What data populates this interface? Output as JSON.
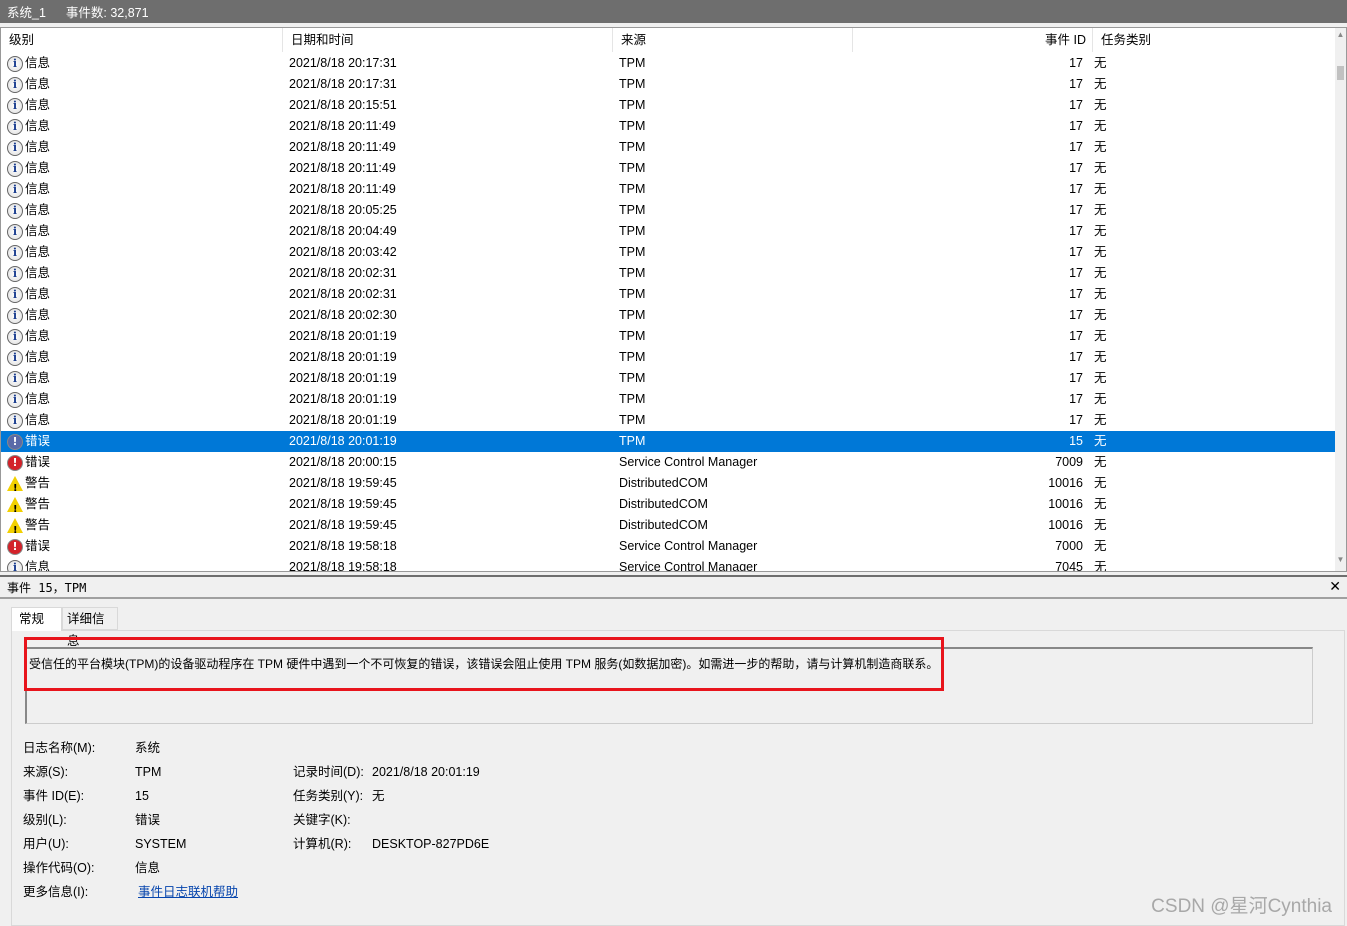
{
  "title": {
    "log": "系统_1",
    "count": "事件数: 32,871"
  },
  "columns": [
    "级别",
    "日期和时间",
    "来源",
    "事件 ID",
    "任务类别"
  ],
  "rows": [
    [
      "info",
      "信息",
      "2021/8/18 20:17:31",
      "TPM",
      "17",
      "无"
    ],
    [
      "info",
      "信息",
      "2021/8/18 20:17:31",
      "TPM",
      "17",
      "无"
    ],
    [
      "info",
      "信息",
      "2021/8/18 20:15:51",
      "TPM",
      "17",
      "无"
    ],
    [
      "info",
      "信息",
      "2021/8/18 20:11:49",
      "TPM",
      "17",
      "无"
    ],
    [
      "info",
      "信息",
      "2021/8/18 20:11:49",
      "TPM",
      "17",
      "无"
    ],
    [
      "info",
      "信息",
      "2021/8/18 20:11:49",
      "TPM",
      "17",
      "无"
    ],
    [
      "info",
      "信息",
      "2021/8/18 20:11:49",
      "TPM",
      "17",
      "无"
    ],
    [
      "info",
      "信息",
      "2021/8/18 20:05:25",
      "TPM",
      "17",
      "无"
    ],
    [
      "info",
      "信息",
      "2021/8/18 20:04:49",
      "TPM",
      "17",
      "无"
    ],
    [
      "info",
      "信息",
      "2021/8/18 20:03:42",
      "TPM",
      "17",
      "无"
    ],
    [
      "info",
      "信息",
      "2021/8/18 20:02:31",
      "TPM",
      "17",
      "无"
    ],
    [
      "info",
      "信息",
      "2021/8/18 20:02:31",
      "TPM",
      "17",
      "无"
    ],
    [
      "info",
      "信息",
      "2021/8/18 20:02:30",
      "TPM",
      "17",
      "无"
    ],
    [
      "info",
      "信息",
      "2021/8/18 20:01:19",
      "TPM",
      "17",
      "无"
    ],
    [
      "info",
      "信息",
      "2021/8/18 20:01:19",
      "TPM",
      "17",
      "无"
    ],
    [
      "info",
      "信息",
      "2021/8/18 20:01:19",
      "TPM",
      "17",
      "无"
    ],
    [
      "info",
      "信息",
      "2021/8/18 20:01:19",
      "TPM",
      "17",
      "无"
    ],
    [
      "info",
      "信息",
      "2021/8/18 20:01:19",
      "TPM",
      "17",
      "无"
    ],
    [
      "errsel",
      "错误",
      "2021/8/18 20:01:19",
      "TPM",
      "15",
      "无"
    ],
    [
      "err",
      "错误",
      "2021/8/18 20:00:15",
      "Service Control Manager",
      "7009",
      "无"
    ],
    [
      "warn",
      "警告",
      "2021/8/18 19:59:45",
      "DistributedCOM",
      "10016",
      "无"
    ],
    [
      "warn",
      "警告",
      "2021/8/18 19:59:45",
      "DistributedCOM",
      "10016",
      "无"
    ],
    [
      "warn",
      "警告",
      "2021/8/18 19:59:45",
      "DistributedCOM",
      "10016",
      "无"
    ],
    [
      "err",
      "错误",
      "2021/8/18 19:58:18",
      "Service Control Manager",
      "7000",
      "无"
    ],
    [
      "info",
      "信息",
      "2021/8/18 19:58:18",
      "Service Control Manager",
      "7045",
      "无"
    ]
  ],
  "selected_index": 18,
  "detail": {
    "header": "事件 15，TPM",
    "tabs": [
      "常规",
      "详细信息"
    ],
    "description": "受信任的平台模块(TPM)的设备驱动程序在 TPM 硬件中遇到一个不可恢复的错误，该错误会阻止使用 TPM 服务(如数据加密)。如需进一步的帮助，请与计算机制造商联系。",
    "log_name_label": "日志名称(M):",
    "log_name": "系统",
    "source_label": "来源(S):",
    "source": "TPM",
    "logged_label": "记录时间(D):",
    "logged": "2021/8/18 20:01:19",
    "event_id_label": "事件 ID(E):",
    "event_id": "15",
    "task_label": "任务类别(Y):",
    "task": "无",
    "level_label": "级别(L):",
    "level": "错误",
    "keywords_label": "关键字(K):",
    "user_label": "用户(U):",
    "user": "SYSTEM",
    "computer_label": "计算机(R):",
    "computer": "DESKTOP-827PD6E",
    "opcode_label": "操作代码(O):",
    "opcode": "信息",
    "more_label": "更多信息(I):",
    "more_link": "事件日志联机帮助"
  },
  "watermark": "CSDN @星河Cynthia"
}
